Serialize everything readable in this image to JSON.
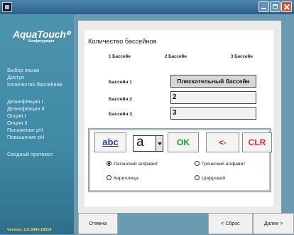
{
  "window": {
    "title": ""
  },
  "sidebar": {
    "logo": "AquaTouch",
    "logo_sub": "Конфигурация",
    "items": [
      {
        "label": "Выбор языка"
      },
      {
        "label": "Доступ"
      },
      {
        "label": "Количество бассейнов"
      },
      {
        "label": "Дезинфекция I"
      },
      {
        "label": "Дезинфекция II"
      },
      {
        "label": "Опции I"
      },
      {
        "label": "Опции II"
      },
      {
        "label": "Понижение pH"
      },
      {
        "label": "Повышение pH"
      },
      {
        "label": "Сводный протокол"
      }
    ],
    "version": "Version: 2.0.3405.18519"
  },
  "main": {
    "title": "Количество бассейнов",
    "column_headers": [
      "1 Бассейн",
      "2 Бассейн",
      "3 Бассейн"
    ],
    "rows": [
      {
        "label": "Бассейн 1",
        "value": "Плескательный бассейн"
      },
      {
        "label": "Бассейн 2",
        "value": "2"
      },
      {
        "label": "Бассейн 3",
        "value": "3"
      }
    ]
  },
  "keyboard": {
    "abc_label": "abc",
    "char_value": "a",
    "ok_label": "OK",
    "back_label": "<-",
    "clr_label": "CLR",
    "radios": [
      {
        "label": "Латинский алфавит",
        "checked": true
      },
      {
        "label": "Греческий алфавит",
        "checked": false
      },
      {
        "label": "Кириллица",
        "checked": false
      },
      {
        "label": "Цифровой",
        "checked": false
      }
    ]
  },
  "footer": {
    "cancel_label": "Отмена",
    "reset_label": "< Сброс",
    "next_label": "Далее >"
  },
  "colors": {
    "ok": "#1a9a28",
    "danger": "#d8341c",
    "abc": "#2a3f9a",
    "version": "#ffd24a"
  }
}
